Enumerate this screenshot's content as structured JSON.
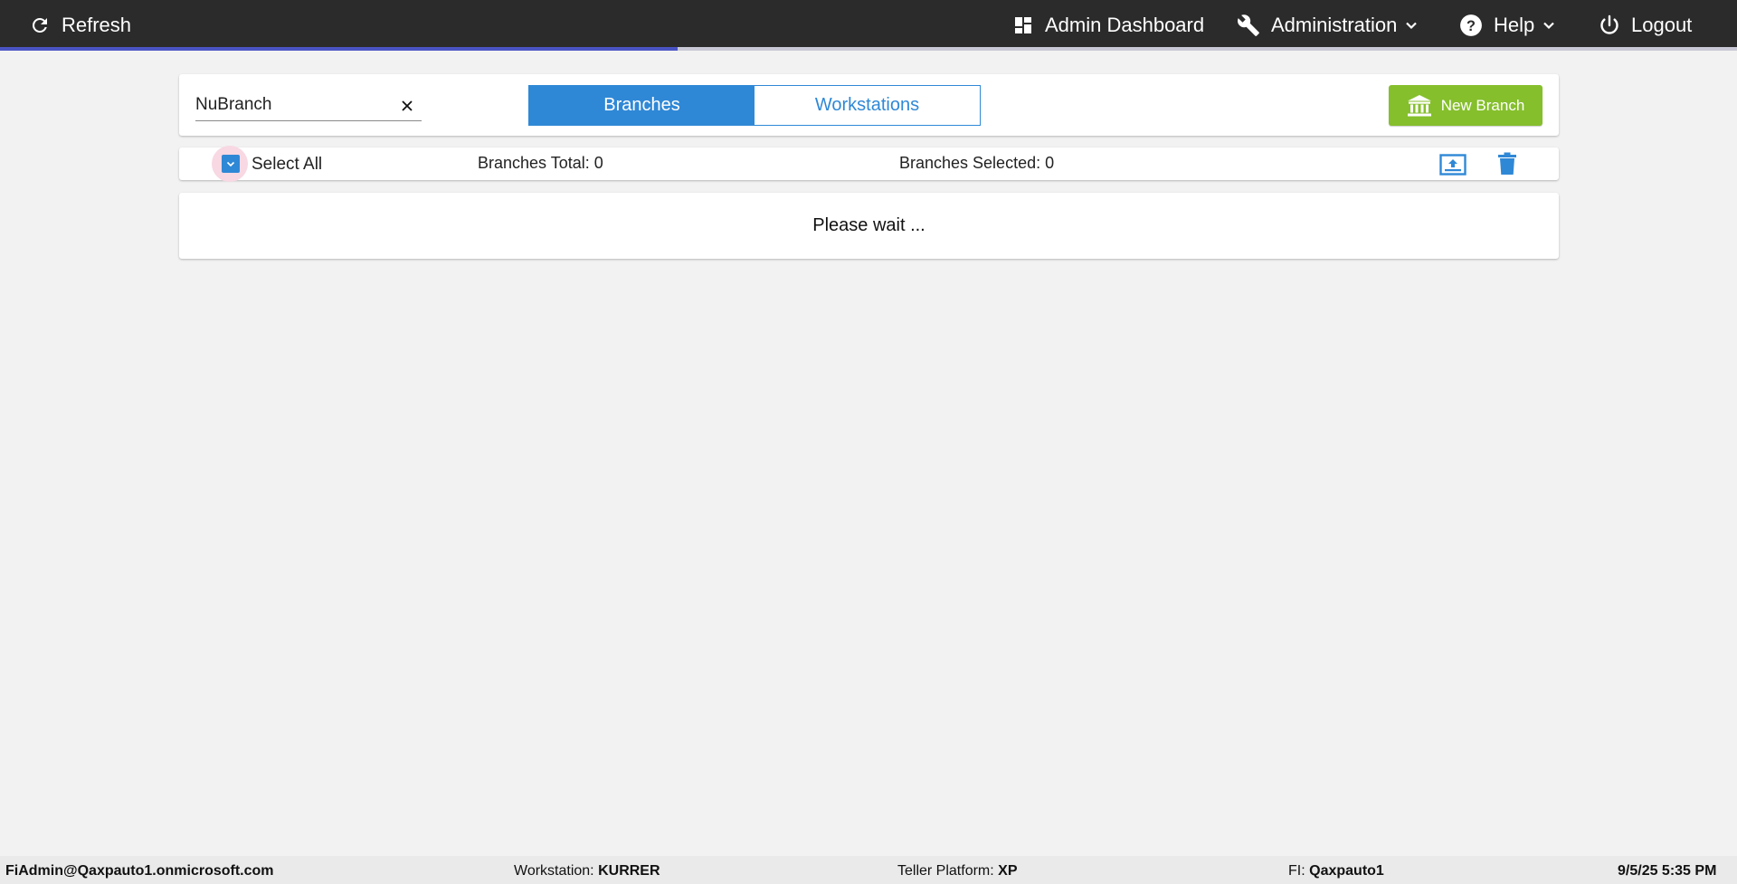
{
  "topbar": {
    "refresh_label": "Refresh",
    "dashboard_label": "Admin Dashboard",
    "administration_label": "Administration",
    "help_label": "Help",
    "logout_label": "Logout",
    "loading_progress": 0.39,
    "icons": {
      "refresh": "refresh-icon",
      "dashboard": "dashboard-grid-icon",
      "administration": "wrench-icon",
      "help": "help-circle-icon",
      "logout": "power-icon",
      "dropdown": "chevron-down-icon"
    }
  },
  "toolbar": {
    "search_value": "NuBranch",
    "tabs": [
      {
        "label": "Branches",
        "active": true
      },
      {
        "label": "Workstations",
        "active": false
      }
    ],
    "new_branch_label": "New Branch"
  },
  "selection_bar": {
    "select_all_label": "Select All",
    "branches_total": "Branches Total: 0",
    "branches_selected": "Branches Selected: 0"
  },
  "message": {
    "text": "Please wait ..."
  },
  "footer": {
    "user": "FiAdmin@Qaxpauto1.onmicrosoft.com",
    "workstation_label": "Workstation:",
    "workstation_value": "KURRER",
    "teller_platform_label": "Teller Platform:",
    "teller_platform_value": "XP",
    "fi_label": "FI:",
    "fi_value": "Qaxpauto1",
    "datetime": "9/5/25 5:35 PM"
  },
  "colors": {
    "topbar_bg": "#2b2b2b",
    "accent_blue": "#2f88d6",
    "new_branch_green": "#85bf2c",
    "progress": "#4a54c4",
    "page_bg": "#f2f2f2"
  }
}
